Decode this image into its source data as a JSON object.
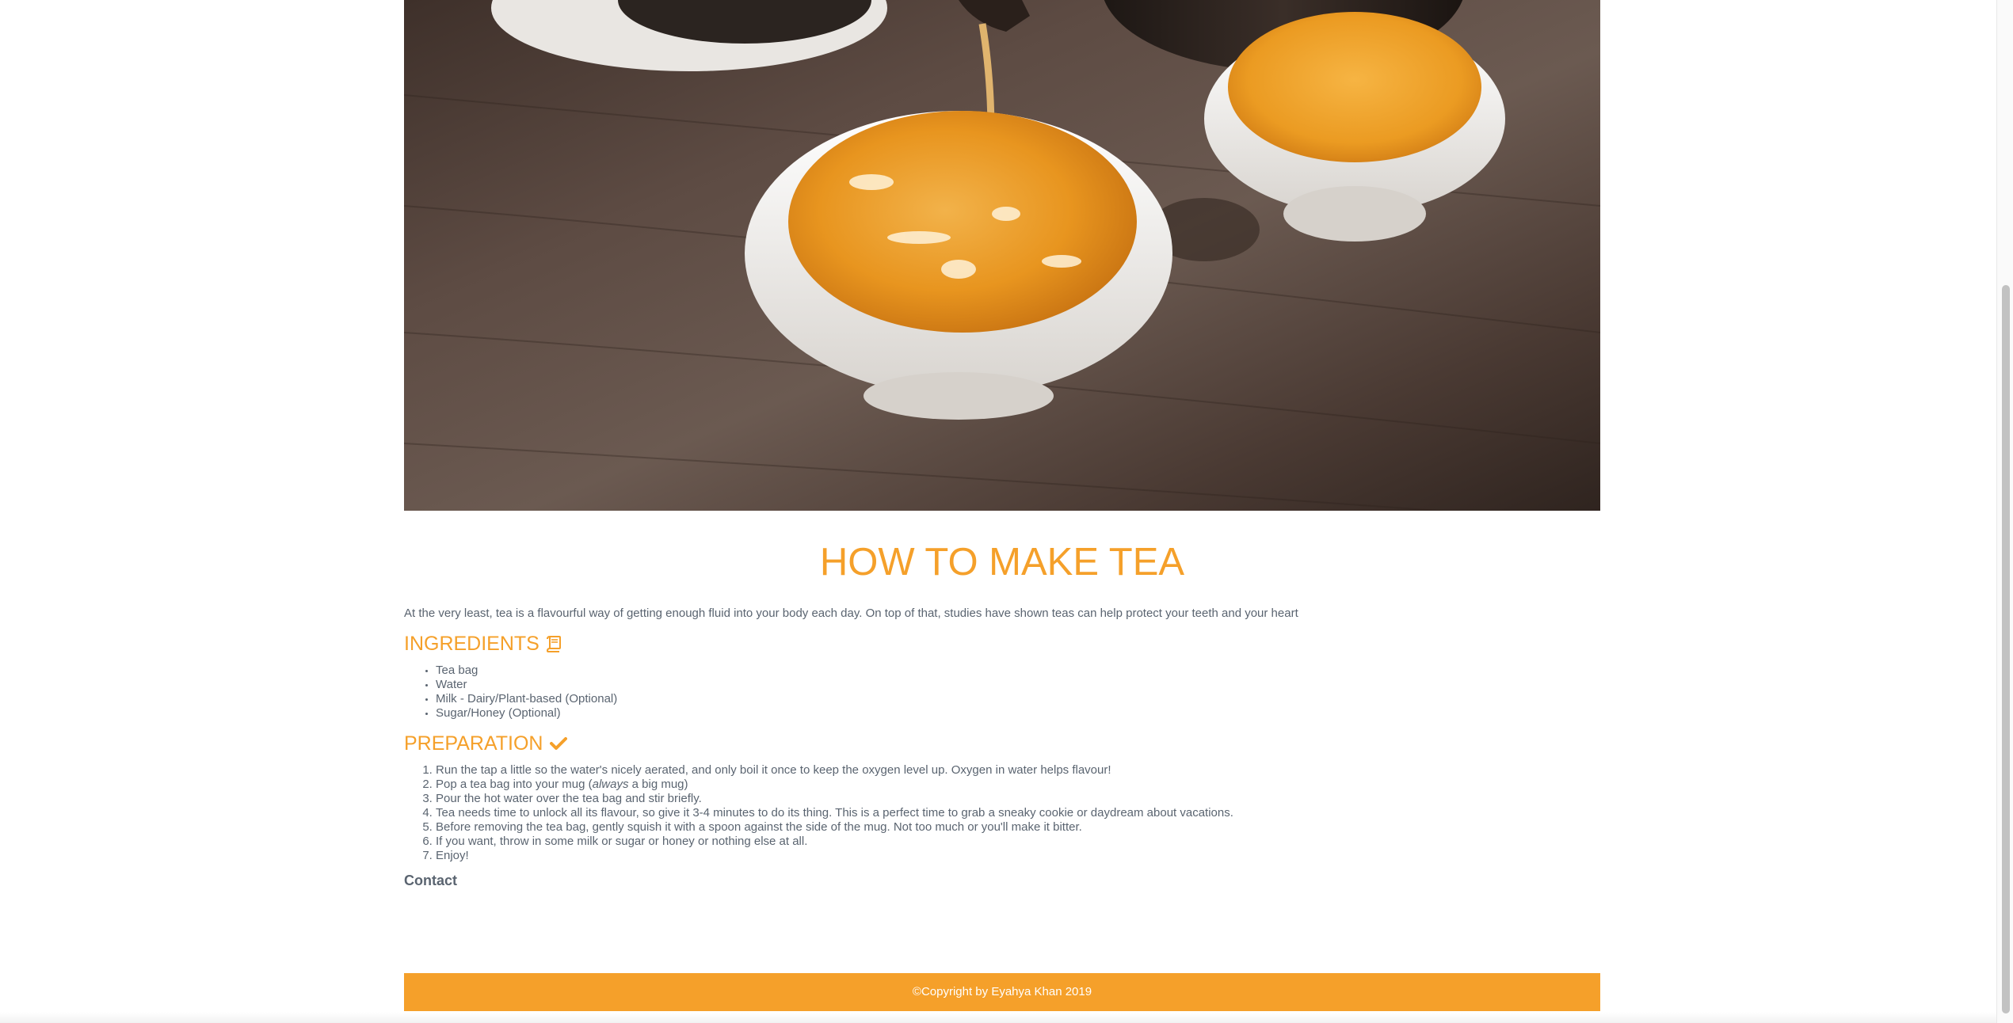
{
  "hero": {
    "image_alt": "Tea being poured into white cups"
  },
  "page": {
    "title": "HOW TO MAKE TEA",
    "intro": "At the very least, tea is a flavourful way of getting enough fluid into your body each day. On top of that, studies have shown teas can help protect your teeth and your heart"
  },
  "ingredients": {
    "heading": "INGREDIENTS",
    "icon": "book-icon",
    "items": [
      "Tea bag",
      "Water",
      "Milk - Dairy/Plant-based (Optional)",
      "Sugar/Honey (Optional)"
    ]
  },
  "preparation": {
    "heading": "PREPARATION",
    "icon": "check-icon",
    "steps": [
      "Run the tap a little so the water's nicely aerated, and only boil it once to keep the oxygen level up. Oxygen in water helps flavour!",
      "Pop a tea bag into your mug (always a big mug)",
      "Pour the hot water over the tea bag and stir briefly.",
      "Tea needs time to unlock all its flavour, so give it 3-4 minutes to do its thing. This is a perfect time to grab a sneaky cookie or daydream about vacations.",
      "Before removing the tea bag, gently squish it with a spoon against the side of the mug. Not too much or you'll make it bitter.",
      "If you want, throw in some milk or sugar or honey or nothing else at all.",
      "Enjoy!"
    ]
  },
  "contact": {
    "label": "Contact"
  },
  "footer": {
    "text": "©Copyright by Eyahya Khan 2019"
  },
  "colors": {
    "accent": "#f5a02a",
    "text": "#5a6470",
    "footer_text": "#ffffff"
  }
}
